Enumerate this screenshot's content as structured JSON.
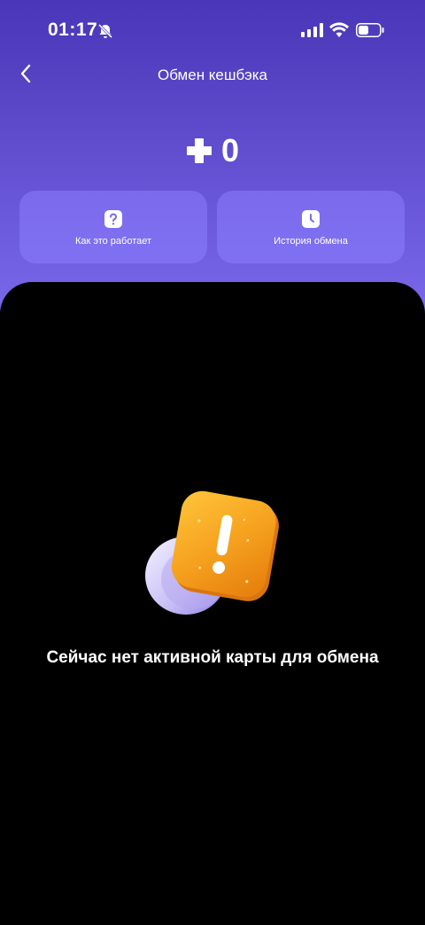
{
  "status_bar": {
    "time": "01:17"
  },
  "header": {
    "title": "Обмен кешбэка"
  },
  "balance": {
    "value": "0"
  },
  "actions": [
    {
      "label": "Как это работает"
    },
    {
      "label": "История обмена"
    }
  ],
  "empty_state": {
    "message": "Сейчас нет активной карты для обмена"
  },
  "icons": {
    "status": [
      "bell-off-icon",
      "signal-icon",
      "wifi-icon",
      "battery-icon"
    ],
    "header": [
      "back-arrow-icon"
    ],
    "balance": [
      "plus-icon"
    ],
    "actions": [
      "question-icon",
      "clock-icon"
    ]
  },
  "colors": {
    "gradient_top": "#4a36b8",
    "gradient_bottom": "#7a6aeb",
    "card_bg": "#8c7dff",
    "coin_orange": "#f6a21f",
    "background": "#000000"
  }
}
